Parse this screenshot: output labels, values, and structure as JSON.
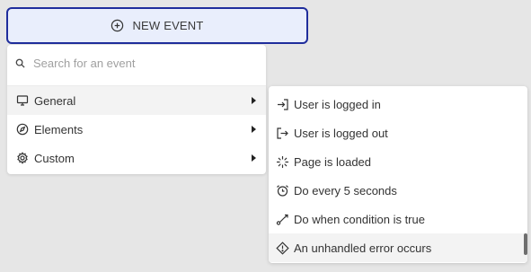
{
  "button": {
    "label": "NEW EVENT",
    "icon": "plus-circle-icon"
  },
  "search": {
    "placeholder": "Search for an event",
    "value": "",
    "icon": "search-icon"
  },
  "menu": {
    "items": [
      {
        "label": "General",
        "icon": "monitor-icon"
      },
      {
        "label": "Elements",
        "icon": "compass-icon"
      },
      {
        "label": "Custom",
        "icon": "gear-icon"
      }
    ]
  },
  "submenu": {
    "items": [
      {
        "label": "User is logged in",
        "icon": "login-icon"
      },
      {
        "label": "User is logged out",
        "icon": "logout-icon"
      },
      {
        "label": "Page is loaded",
        "icon": "loader-icon"
      },
      {
        "label": "Do every 5 seconds",
        "icon": "alarm-clock-icon"
      },
      {
        "label": "Do when condition is true",
        "icon": "route-icon"
      },
      {
        "label": "An unhandled error occurs",
        "icon": "warning-diamond-icon"
      }
    ]
  },
  "colors": {
    "accent": "#1f2d9c",
    "button_bg": "#e9eefc",
    "hover_bg": "#f3f3f3",
    "page_bg": "#e6e6e6"
  }
}
